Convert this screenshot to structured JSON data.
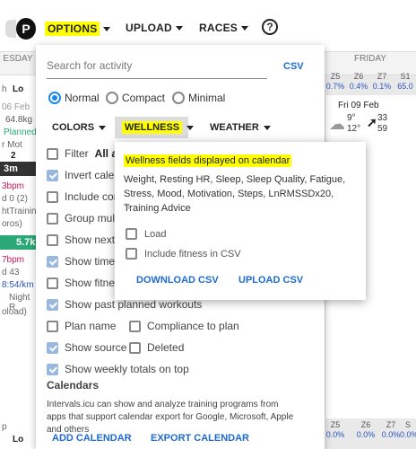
{
  "topbar": {
    "logo_text": "P",
    "menus": [
      {
        "label": "OPTIONS"
      },
      {
        "label": "UPLOAD"
      },
      {
        "label": "RACES"
      },
      {
        "label": "WEATHER"
      }
    ],
    "help_label": "?"
  },
  "calendar_bg": {
    "left_header": "ESDAY",
    "friday_header": "FRIDAY",
    "zones": [
      {
        "label": "Z5",
        "value": "0.7%"
      },
      {
        "label": "Z6",
        "value": "0.4%"
      },
      {
        "label": "Z7",
        "value": "0.1%"
      },
      {
        "label": "S1",
        "value": "65.0"
      }
    ],
    "bottom_zones": [
      {
        "label": "Z5",
        "value": "0.0%"
      },
      {
        "label": "Z6",
        "value": "0.0%"
      },
      {
        "label": "Z7",
        "value": "0.0%"
      },
      {
        "label": "S",
        "value": "0.0%"
      }
    ],
    "left_items": [
      "h",
      "Lo",
      "06 Feb",
      "64.8kg",
      "Planned",
      "r Mot",
      "2",
      "3m",
      "3bpm",
      "d 0 (2)",
      "htTraining",
      "oros)",
      "5.7k",
      "7bpm",
      "d 43",
      "8:54/km",
      "Night R",
      "oload)",
      "p",
      "Lo"
    ],
    "friday_date": "Fri 09 Feb",
    "friday_temp_high": "9°",
    "friday_temp_low": "12°",
    "friday_wind1": "33",
    "friday_wind2": "59"
  },
  "options": {
    "search_placeholder": "Search for activity",
    "csv_label": "CSV",
    "view_modes": [
      {
        "label": "Normal",
        "selected": true
      },
      {
        "label": "Compact",
        "selected": false
      },
      {
        "label": "Minimal",
        "selected": false
      }
    ],
    "tabs": {
      "colors": "COLORS",
      "wellness": "WELLNESS",
      "weather": "WEATHER"
    },
    "filter_label": "Filter",
    "filter_value": "All ac",
    "checkboxes": [
      {
        "label": "Invert calend",
        "checked": true
      },
      {
        "label": "Include com",
        "checked": false
      },
      {
        "label": "Group multis",
        "checked": false
      },
      {
        "label": "Show next w",
        "checked": false
      },
      {
        "label": "Show time in",
        "checked": true
      },
      {
        "label": "Show fitness",
        "checked": false
      },
      {
        "label": "Show past planned workouts",
        "checked": true
      }
    ],
    "plan_name": "Plan name",
    "compliance": "Compliance to plan",
    "show_source": "Show source",
    "deleted": "Deleted",
    "weekly_totals": "Show weekly totals on top",
    "calendars_heading": "Calendars",
    "calendars_text": "Intervals.icu can show and analyze training programs from apps that support calendar export for Google, Microsoft, Apple and others",
    "add_calendar": "ADD CALENDAR",
    "export_calendar": "EXPORT CALENDAR"
  },
  "wellness_popup": {
    "heading": "Wellness fields displayed on calendar",
    "fields": "Weight, Resting HR, Sleep, Sleep Quality, Fatigue, Stress, Mood, Motivation, Steps, LnRMSSDx20, Training Advice",
    "load_label": "Load",
    "fitness_csv_label": "Include fitness in CSV",
    "download_csv": "DOWNLOAD CSV",
    "upload_csv": "UPLOAD CSV"
  },
  "colors": {
    "accent": "#1e6ad2",
    "highlight": "#ffff00",
    "tile_dark": "#333333",
    "tile_green": "#2aa876"
  }
}
